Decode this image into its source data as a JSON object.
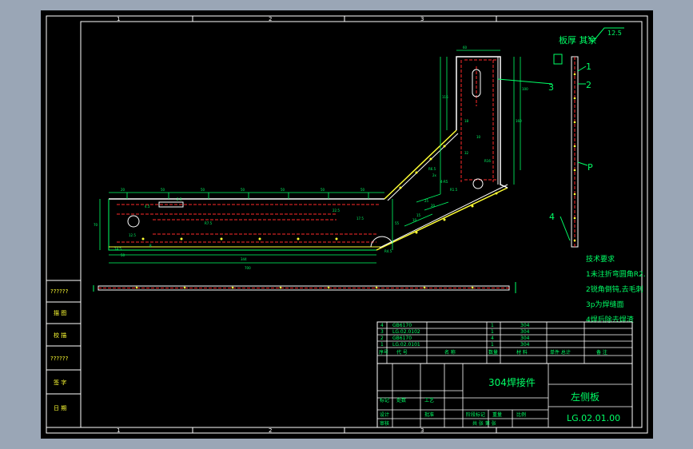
{
  "colors": {
    "background": "#000000",
    "frame": "#ffffff",
    "dimension": "#00ff66",
    "hidden_line": "#ff2a2a",
    "outline": "#ffffff",
    "weld": "#ffff33",
    "surround": "#9aa6b6"
  },
  "grid_refs": {
    "top": [
      "1",
      "2",
      "3"
    ],
    "bottom": [
      "1",
      "2",
      "3"
    ]
  },
  "notes": {
    "roughness_text": "板厚 其余",
    "roughness_value": "12.5",
    "tech_title": "技术要求",
    "tech_items": [
      "1未注折弯圆角R2.",
      "2锐角倒钝,去毛刺",
      "3p为焊缝面",
      "4焊后除去焊渣"
    ]
  },
  "leaders": {
    "l1": "1",
    "l2": "2",
    "l3": "3",
    "l4": "4",
    "lp": "P"
  },
  "side_strip": {
    "cells": [
      "??????",
      "描 图",
      "校 描",
      "??????",
      "签 字",
      "日 期"
    ]
  },
  "bom": {
    "rows": [
      {
        "no": "4",
        "code": "GB6170",
        "name": "",
        "qty": "1",
        "mat": "304",
        "note": ""
      },
      {
        "no": "3",
        "code": "LG.02.0102",
        "name": "",
        "qty": "1",
        "mat": "304",
        "note": ""
      },
      {
        "no": "2",
        "code": "GB6170",
        "name": "",
        "qty": "4",
        "mat": "304",
        "note": ""
      },
      {
        "no": "1",
        "code": "LG.02.0101",
        "name": "",
        "qty": "1",
        "mat": "304",
        "note": ""
      }
    ],
    "header": {
      "no": "序号",
      "code": "代  号",
      "name": "名  称",
      "qty": "数量",
      "mat": "材  料",
      "weight": "单件 总计",
      "note": "备  注"
    }
  },
  "title_block": {
    "material_name": "304焊接件",
    "part_name": "左侧板",
    "drawing_no": "LG.02.01.00",
    "company": "",
    "labels": {
      "mark": "标记",
      "zones": "处数",
      "design": "设计",
      "review": "审核",
      "process": "工艺",
      "approve": "批准",
      "stage": "阶段标记",
      "weight": "重量",
      "scale": "比例",
      "sheet": "共 张 第 张"
    }
  }
}
